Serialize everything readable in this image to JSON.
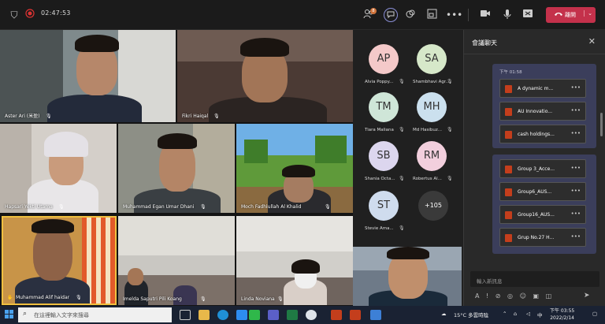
{
  "topbar": {
    "timer": "02:47:53",
    "chat_badge": "8",
    "leave_label": "離開",
    "icons": [
      "shield-icon",
      "record-icon",
      "people-icon",
      "chat-icon",
      "reactions-icon",
      "rooms-icon",
      "more-icon",
      "camera-icon",
      "mic-icon",
      "share-icon",
      "phone-icon"
    ]
  },
  "grid": {
    "tiles": [
      {
        "name": "Aster Ari (米盈)"
      },
      {
        "name": "Fikri Haiqal"
      },
      {
        "name": "Hapsari Yekti Utama"
      },
      {
        "name": "Muhammad Egan Umar Dhani"
      },
      {
        "name": "Moch Fadhlullah Al Khalid"
      },
      {
        "name": "Muhammad Alif haidar"
      },
      {
        "name": "Imelda Saputri Pili Koang"
      },
      {
        "name": "Linda Noviana"
      }
    ]
  },
  "roster": {
    "people": [
      {
        "initials": "AP",
        "name": "Alvia Poppy...",
        "color": "#f4c9c9"
      },
      {
        "initials": "SA",
        "name": "Shambhavi Agr...",
        "color": "#d6e8c9"
      },
      {
        "initials": "TM",
        "name": "Tiara Maliana",
        "color": "#cfe6d8"
      },
      {
        "initials": "MH",
        "name": "Md Hasibuz...",
        "color": "#cbe0ee"
      },
      {
        "initials": "SB",
        "name": "Shania Octa...",
        "color": "#dcd6ee"
      },
      {
        "initials": "RM",
        "name": "Robertus Al...",
        "color": "#f2cfdd"
      },
      {
        "initials": "ST",
        "name": "Stevie Ama...",
        "color": "#cfdcee"
      }
    ],
    "overflow": "+105"
  },
  "chat": {
    "title": "會議聊天",
    "block1": {
      "timestamp": "下午 01:58",
      "files": [
        "A dynamic m...",
        "AU Innovatio...",
        "cash holdings..."
      ]
    },
    "block2": {
      "files": [
        "Group 3_Acce...",
        "Group6_AUS...",
        "Group16_AUS...",
        "Grup No.27 H..."
      ]
    },
    "input_placeholder": "輸入新訊息"
  },
  "taskbar": {
    "search_placeholder": "在這裡輸入文字來搜尋",
    "weather": "15°C 多雲時陰",
    "time": "下午 03:55",
    "date": "2022/2/14"
  }
}
